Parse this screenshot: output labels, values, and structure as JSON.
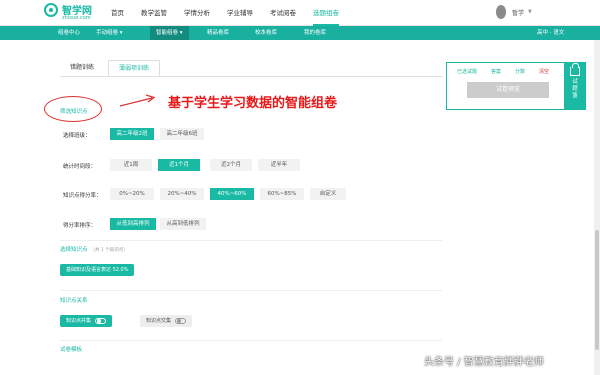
{
  "logo": {
    "title": "智学网",
    "sub": "zhixue.com"
  },
  "topnav": [
    "首页",
    "教学监管",
    "学情分析",
    "学业辅导",
    "考试阅卷",
    "选题组卷"
  ],
  "user": {
    "name": "暂学"
  },
  "subnav": [
    "组卷中心",
    "手动组卷",
    "智能组卷",
    "精品卷库",
    "校本卷库",
    "我的卷库"
  ],
  "grade": "高中 · 语文",
  "tabs": [
    "错题训练",
    "薄弱项训练"
  ],
  "annotation": {
    "circle_label": "筛选知识点",
    "headline": "基于学生学习数据的智能组卷"
  },
  "filters": {
    "class": {
      "label": "选择班级：",
      "options": [
        "高二年级2班",
        "高二年级6班"
      ],
      "selected": 0
    },
    "time": {
      "label": "统计时间段：",
      "options": [
        "近1周",
        "近1个月",
        "近2个月",
        "近半年"
      ],
      "selected": 1
    },
    "rate": {
      "label": "知识点得分率：",
      "options": [
        "0%~20%",
        "20%~40%",
        "40%~60%",
        "60%~85%",
        "自定义"
      ],
      "selected": 2
    },
    "sort": {
      "label": "得分率排序：",
      "options": [
        "从低到高排列",
        "从高到低排列"
      ],
      "selected": 0
    }
  },
  "selected_points": {
    "title": "选择知识点",
    "count": "（共 1 个知识点）",
    "item": "基础知识及语言表达 52.0%"
  },
  "relation": {
    "title": "知识点关系",
    "options": [
      "知识点并集",
      "知识点交集"
    ]
  },
  "template": {
    "title": "试卷模板"
  },
  "panel": {
    "links": [
      "已选试题",
      "答案",
      "分数",
      "清空"
    ],
    "preview": "试卷预览"
  },
  "basket": {
    "label": "试题篮"
  },
  "watermark": "头条号 / 智慧教育胖胖老师"
}
